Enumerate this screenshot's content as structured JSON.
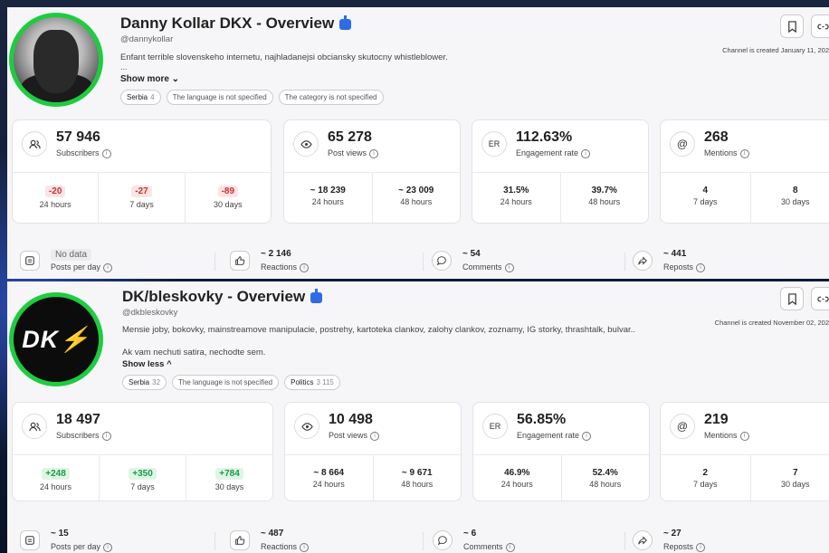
{
  "channels": [
    {
      "title": "Danny Kollar DKX - Overview",
      "handle": "@dannykollar",
      "description": "Enfant terrible slovenskeho internetu, najhladanejsi obciansky skutocny whistleblower.",
      "ellipsis": "...",
      "toggle": "Show more ⌄",
      "tags": [
        {
          "label": "Serbia",
          "count": "4"
        },
        {
          "label": "The language is not specified",
          "count": ""
        },
        {
          "label": "The category is not specified",
          "count": ""
        }
      ],
      "created": "Channel is created January 11, 202",
      "subscribers": {
        "value": "57 946",
        "label": "Subscribers",
        "cells": [
          {
            "value": "-20",
            "label": "24 hours",
            "tone": "neg"
          },
          {
            "value": "-27",
            "label": "7 days",
            "tone": "neg"
          },
          {
            "value": "-89",
            "label": "30 days",
            "tone": "neg"
          }
        ]
      },
      "views": {
        "value": "65 278",
        "label": "Post views",
        "cells": [
          {
            "value": "~ 18 239",
            "label": "24 hours"
          },
          {
            "value": "~ 23 009",
            "label": "48 hours"
          }
        ]
      },
      "er": {
        "icon_text": "ER",
        "value": "112.63%",
        "label": "Engagement rate",
        "cells": [
          {
            "value": "31.5%",
            "label": "24 hours"
          },
          {
            "value": "39.7%",
            "label": "48 hours"
          }
        ]
      },
      "mentions": {
        "value": "268",
        "label": "Mentions",
        "cells": [
          {
            "value": "4",
            "label": "7 days"
          },
          {
            "value": "8",
            "label": "30 days"
          }
        ]
      },
      "posts": {
        "value": "No data",
        "label": "Posts per day"
      },
      "reactions": {
        "value": "~ 2 146",
        "label": "Reactions"
      },
      "comments": {
        "value": "~ 54",
        "label": "Comments"
      },
      "reposts": {
        "value": "~ 441",
        "label": "Reposts"
      }
    },
    {
      "title": "DK/bleskovky - Overview",
      "handle": "@dkbleskovky",
      "description": "Mensie joby, bokovky, mainstreamove manipulacie, postrehy, kartoteka clankov, zalohy clankov, zoznamy, IG storky, thrashtalk, bulvar..",
      "description2": "Ak vam nechuti satira, nechodte sem.",
      "toggle": "Show less ^",
      "avatar_text": "DK",
      "avatar_bolt": "⚡",
      "tags": [
        {
          "label": "Serbia",
          "count": "32"
        },
        {
          "label": "The language is not specified",
          "count": ""
        },
        {
          "label": "Politics",
          "count": "3 115"
        }
      ],
      "created": "Channel is created November 02, 202",
      "subscribers": {
        "value": "18 497",
        "label": "Subscribers",
        "cells": [
          {
            "value": "+248",
            "label": "24 hours",
            "tone": "pos"
          },
          {
            "value": "+350",
            "label": "7 days",
            "tone": "pos"
          },
          {
            "value": "+784",
            "label": "30 days",
            "tone": "pos"
          }
        ]
      },
      "views": {
        "value": "10 498",
        "label": "Post views",
        "cells": [
          {
            "value": "~ 8 664",
            "label": "24 hours"
          },
          {
            "value": "~ 9 671",
            "label": "48 hours"
          }
        ]
      },
      "er": {
        "icon_text": "ER",
        "value": "56.85%",
        "label": "Engagement rate",
        "cells": [
          {
            "value": "46.9%",
            "label": "24 hours"
          },
          {
            "value": "52.4%",
            "label": "48 hours"
          }
        ]
      },
      "mentions": {
        "value": "219",
        "label": "Mentions",
        "cells": [
          {
            "value": "2",
            "label": "7 days"
          },
          {
            "value": "7",
            "label": "30 days"
          }
        ]
      },
      "posts": {
        "value": "~ 15",
        "label": "Posts per day"
      },
      "reactions": {
        "value": "~ 487",
        "label": "Reactions"
      },
      "comments": {
        "value": "~ 6",
        "label": "Comments"
      },
      "reposts": {
        "value": "~ 27",
        "label": "Reposts"
      }
    }
  ],
  "colors": {
    "accent_green": "#1dcc3f",
    "negative": "#d42d2d",
    "positive": "#1a9a47",
    "bot_badge": "#2f6be6"
  },
  "icons": [
    "users-icon",
    "eye-icon",
    "at-icon",
    "bookmark-icon",
    "link-icon",
    "calendar-icon",
    "thumbs-up-icon",
    "comment-icon",
    "repost-icon",
    "info-icon"
  ]
}
